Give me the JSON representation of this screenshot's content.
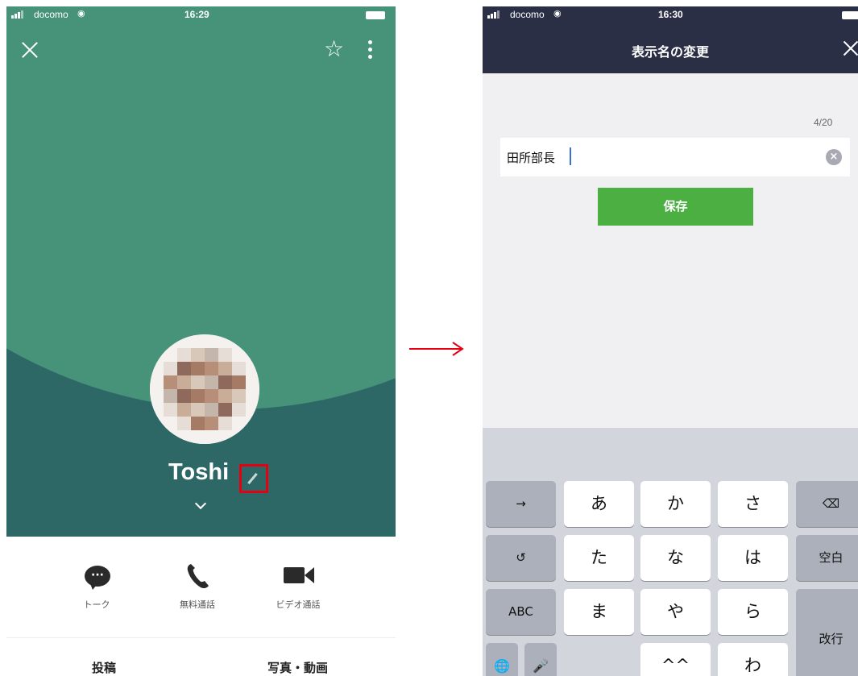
{
  "left_screen": {
    "status": {
      "carrier": "docomo",
      "time": "16:29"
    },
    "profile": {
      "name": "Toshi"
    },
    "actions": [
      {
        "icon": "chat-bubble-icon",
        "label": "トーク"
      },
      {
        "icon": "phone-icon",
        "label": "無料通話"
      },
      {
        "icon": "video-camera-icon",
        "label": "ビデオ通話"
      }
    ],
    "tabs": [
      "投稿",
      "写真・動画"
    ],
    "colors": {
      "header_green": "#46937a",
      "header_teal": "#2e6866",
      "highlight": "#e60012"
    }
  },
  "right_screen": {
    "status": {
      "carrier": "docomo",
      "time": "16:30"
    },
    "header": {
      "title": "表示名の変更"
    },
    "counter": "4/20",
    "name_input": {
      "value": "田所部長"
    },
    "save_label": "保存",
    "colors": {
      "header_bg": "#2b2f45",
      "save_button": "#4caf42"
    },
    "keyboard": {
      "rows": [
        [
          "→",
          "あ",
          "か",
          "さ",
          "⌫"
        ],
        [
          "↺",
          "た",
          "な",
          "は",
          "空白"
        ],
        [
          "ABC",
          "ま",
          "や",
          "ら",
          "改行"
        ],
        [
          "🌐",
          "🎤",
          "^^",
          "わ",
          "、。?!"
        ]
      ]
    }
  }
}
